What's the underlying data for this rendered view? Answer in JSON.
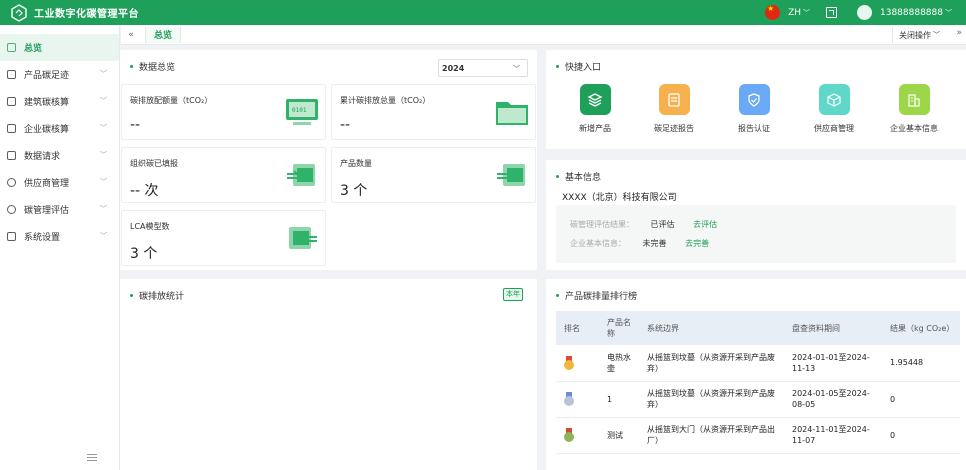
{
  "app": {
    "title": "工业数字化碳管理平台"
  },
  "topbar": {
    "language": "ZH",
    "phone": "13888888888"
  },
  "sidebar": {
    "items": [
      {
        "label": "总览",
        "active": true,
        "has_children": false
      },
      {
        "label": "产品碳足迹",
        "has_children": true
      },
      {
        "label": "建筑碳核算",
        "has_children": true
      },
      {
        "label": "企业碳核算",
        "has_children": true
      },
      {
        "label": "数据请求",
        "has_children": true
      },
      {
        "label": "供应商管理",
        "has_children": true
      },
      {
        "label": "碳管理评估",
        "has_children": true
      },
      {
        "label": "系统设置",
        "has_children": true
      }
    ]
  },
  "tabs": {
    "current": "总览",
    "close_ops": "关闭操作"
  },
  "overview": {
    "title": "数据总览",
    "year": "2024",
    "cards": [
      {
        "label": "碳排放配额量（tCO₂）",
        "value": "--"
      },
      {
        "label": "累计碳排放总量（tCO₂）",
        "value": "--"
      },
      {
        "label": "组织碳已填报",
        "value": "-- 次"
      },
      {
        "label": "产品数量",
        "value": "3 个"
      },
      {
        "label": "LCA模型数",
        "value": "3 个"
      }
    ]
  },
  "quick": {
    "title": "快捷入口",
    "items": [
      {
        "label": "新增产品",
        "color": "#1fa05a"
      },
      {
        "label": "碳足迹报告",
        "color": "#f6b04e"
      },
      {
        "label": "报告认证",
        "color": "#6aa9f5"
      },
      {
        "label": "供应商管理",
        "color": "#5fd8c9"
      },
      {
        "label": "企业基本信息",
        "color": "#9ed64a"
      }
    ]
  },
  "basic": {
    "title": "基本信息",
    "company": "XXXX（北京）科技有限公司",
    "rows": [
      {
        "key": "碳管理评估结果：",
        "value": "已评估",
        "link": "去评估"
      },
      {
        "key": "企业基本信息：",
        "value": "未完善",
        "link": "去完善"
      }
    ]
  },
  "emission": {
    "title": "碳排放统计",
    "tag": "本年"
  },
  "ranking": {
    "title": "产品碳排量排行榜",
    "headers": [
      "排名",
      "产品名称",
      "系统边界",
      "盘查资料期间",
      "结果（kg CO₂e）"
    ],
    "rows": [
      {
        "name": "电热水壶",
        "boundary": "从摇篮到坟墓（从资源开采到产品废弃）",
        "period": "2024-01-01至2024-11-13",
        "result": "1.95448",
        "medal": "gold"
      },
      {
        "name": "1",
        "boundary": "从摇篮到坟墓（从资源开采到产品废弃）",
        "period": "2024-01-05至2024-08-05",
        "result": "0",
        "medal": "silver"
      },
      {
        "name": "测试",
        "boundary": "从摇篮到大门（从资源开采到产品出厂）",
        "period": "2024-11-01至2024-11-07",
        "result": "0",
        "medal": "bronze"
      }
    ]
  },
  "colors": {
    "brand": "#1fa05a"
  }
}
